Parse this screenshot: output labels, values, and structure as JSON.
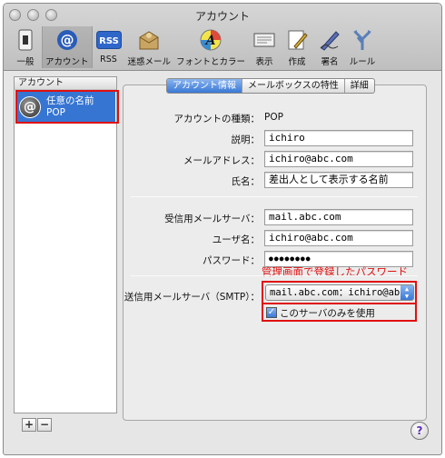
{
  "window": {
    "title": "アカウント"
  },
  "toolbar": {
    "items": [
      {
        "label": "一般",
        "icon": "switch-icon"
      },
      {
        "label": "アカウント",
        "icon": "at-icon"
      },
      {
        "label": "RSS",
        "icon": "rss-icon"
      },
      {
        "label": "迷惑メール",
        "icon": "junk-mail-icon"
      },
      {
        "label": "フォントとカラー",
        "icon": "font-color-icon"
      },
      {
        "label": "表示",
        "icon": "display-icon"
      },
      {
        "label": "作成",
        "icon": "compose-icon"
      },
      {
        "label": "署名",
        "icon": "signature-icon"
      },
      {
        "label": "ルール",
        "icon": "rules-icon"
      }
    ],
    "rss_badge": "RSS",
    "font_badge": "A"
  },
  "sidebar": {
    "header": "アカウント",
    "account": {
      "name": "任意の名前",
      "type": "POP",
      "avatar_glyph": "@"
    },
    "add_label": "+",
    "remove_label": "−"
  },
  "tabs": [
    "アカウント情報",
    "メールボックスの特性",
    "詳細"
  ],
  "form": {
    "account_type": {
      "label": "アカウントの種類：",
      "value": "POP"
    },
    "description": {
      "label": "説明：",
      "value": "ichiro"
    },
    "email": {
      "label": "メールアドレス：",
      "value": "ichiro@abc.com"
    },
    "full_name": {
      "label": "氏名：",
      "value": "差出人として表示する名前"
    },
    "incoming_server": {
      "label": "受信用メールサーバ：",
      "value": "mail.abc.com"
    },
    "username": {
      "label": "ユーザ名：",
      "value": "ichiro@abc.com"
    },
    "password": {
      "label": "パスワード：",
      "value": "●●●●●●●●"
    },
    "smtp": {
      "label": "送信用メールサーバ（SMTP）：",
      "value": "mail.abc.com：ichiro@abc"
    },
    "only_this_server": {
      "label": "このサーバのみを使用",
      "checked": true
    }
  },
  "annotation": {
    "text": "管理画面で登録したパスワード",
    "color": "#e01010"
  },
  "help": {
    "glyph": "?"
  },
  "colors": {
    "accent": "#3675d2",
    "annotation": "#e01010"
  }
}
